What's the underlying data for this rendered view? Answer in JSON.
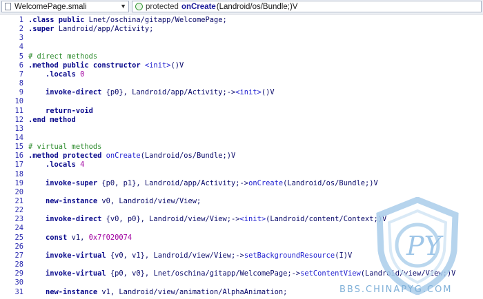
{
  "toolbar": {
    "file_dropdown": "WelcomePage.smali",
    "method_dropdown": {
      "modifier": "protected",
      "name": "onCreate",
      "signature": "(Landroid/os/Bundle;)V"
    }
  },
  "watermark": {
    "logo_letters": "PY",
    "site": "BBS.CHINAPYG.COM"
  },
  "lines": [
    {
      "n": "1",
      "segs": [
        [
          "kw",
          ".class public"
        ],
        [
          "tk",
          " Lnet/oschina/gitapp/WelcomePage;"
        ]
      ]
    },
    {
      "n": "2",
      "segs": [
        [
          "kw",
          ".super"
        ],
        [
          "tk",
          " Landroid/app/Activity;"
        ]
      ]
    },
    {
      "n": "3",
      "segs": []
    },
    {
      "n": "4",
      "segs": []
    },
    {
      "n": "5",
      "segs": [
        [
          "cm",
          "# direct methods"
        ]
      ]
    },
    {
      "n": "6",
      "segs": [
        [
          "kw",
          ".method public constructor"
        ],
        [
          "tk",
          " "
        ],
        [
          "mt",
          "<init>"
        ],
        [
          "tk",
          "()V"
        ]
      ]
    },
    {
      "n": "7",
      "segs": [
        [
          "tk",
          "    "
        ],
        [
          "kw",
          ".locals"
        ],
        [
          "tk",
          " "
        ],
        [
          "nm",
          "0"
        ]
      ]
    },
    {
      "n": "8",
      "segs": []
    },
    {
      "n": "9",
      "segs": [
        [
          "tk",
          "    "
        ],
        [
          "kw",
          "invoke-direct"
        ],
        [
          "tk",
          " {p0}, Landroid/app/Activity;->"
        ],
        [
          "mt",
          "<init>"
        ],
        [
          "tk",
          "()V"
        ]
      ]
    },
    {
      "n": "10",
      "segs": []
    },
    {
      "n": "11",
      "segs": [
        [
          "tk",
          "    "
        ],
        [
          "kw",
          "return-void"
        ]
      ]
    },
    {
      "n": "12",
      "segs": [
        [
          "kw",
          ".end method"
        ]
      ]
    },
    {
      "n": "13",
      "segs": []
    },
    {
      "n": "14",
      "segs": []
    },
    {
      "n": "15",
      "segs": [
        [
          "cm",
          "# virtual methods"
        ]
      ]
    },
    {
      "n": "16",
      "segs": [
        [
          "kw",
          ".method protected"
        ],
        [
          "tk",
          " "
        ],
        [
          "mt",
          "onCreate"
        ],
        [
          "tk",
          "(Landroid/os/Bundle;)V"
        ]
      ]
    },
    {
      "n": "17",
      "segs": [
        [
          "tk",
          "    "
        ],
        [
          "kw",
          ".locals"
        ],
        [
          "tk",
          " "
        ],
        [
          "nm",
          "4"
        ]
      ]
    },
    {
      "n": "18",
      "segs": []
    },
    {
      "n": "19",
      "segs": [
        [
          "tk",
          "    "
        ],
        [
          "kw",
          "invoke-super"
        ],
        [
          "tk",
          " {p0, p1}, Landroid/app/Activity;->"
        ],
        [
          "mt",
          "onCreate"
        ],
        [
          "tk",
          "(Landroid/os/Bundle;)V"
        ]
      ]
    },
    {
      "n": "20",
      "segs": []
    },
    {
      "n": "21",
      "segs": [
        [
          "tk",
          "    "
        ],
        [
          "kw",
          "new-instance"
        ],
        [
          "tk",
          " v0, Landroid/view/View;"
        ]
      ]
    },
    {
      "n": "22",
      "segs": []
    },
    {
      "n": "23",
      "segs": [
        [
          "tk",
          "    "
        ],
        [
          "kw",
          "invoke-direct"
        ],
        [
          "tk",
          " {v0, p0}, Landroid/view/View;->"
        ],
        [
          "mt",
          "<init>"
        ],
        [
          "tk",
          "(Landroid/content/Context;)V"
        ]
      ]
    },
    {
      "n": "24",
      "segs": []
    },
    {
      "n": "25",
      "segs": [
        [
          "tk",
          "    "
        ],
        [
          "kw",
          "const"
        ],
        [
          "tk",
          " v1, "
        ],
        [
          "nm",
          "0x7f020074"
        ]
      ]
    },
    {
      "n": "26",
      "segs": []
    },
    {
      "n": "27",
      "segs": [
        [
          "tk",
          "    "
        ],
        [
          "kw",
          "invoke-virtual"
        ],
        [
          "tk",
          " {v0, v1}, Landroid/view/View;->"
        ],
        [
          "mt",
          "setBackgroundResource"
        ],
        [
          "tk",
          "(I)V"
        ]
      ]
    },
    {
      "n": "28",
      "segs": []
    },
    {
      "n": "29",
      "segs": [
        [
          "tk",
          "    "
        ],
        [
          "kw",
          "invoke-virtual"
        ],
        [
          "tk",
          " {p0, v0}, Lnet/oschina/gitapp/WelcomePage;->"
        ],
        [
          "mt",
          "setContentView"
        ],
        [
          "tk",
          "(Landroid/view/View;)V"
        ]
      ]
    },
    {
      "n": "30",
      "segs": []
    },
    {
      "n": "31",
      "segs": [
        [
          "tk",
          "    "
        ],
        [
          "kw",
          "new-instance"
        ],
        [
          "tk",
          " v1, Landroid/view/animation/AlphaAnimation;"
        ]
      ]
    }
  ]
}
